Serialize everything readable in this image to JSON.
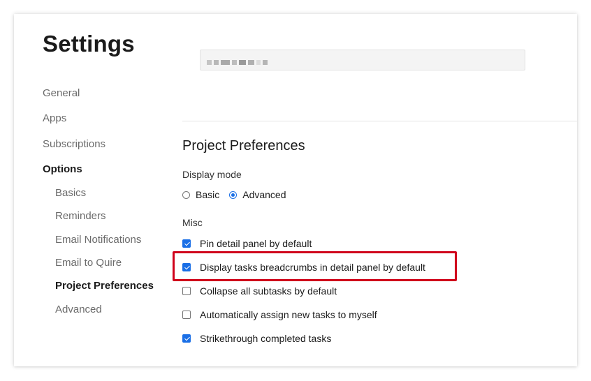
{
  "page": {
    "title": "Settings"
  },
  "sidebar": {
    "items": [
      {
        "label": "General"
      },
      {
        "label": "Apps"
      },
      {
        "label": "Subscriptions"
      },
      {
        "label": "Options"
      }
    ],
    "subitems": [
      {
        "label": "Basics"
      },
      {
        "label": "Reminders"
      },
      {
        "label": "Email Notifications"
      },
      {
        "label": "Email to Quire"
      },
      {
        "label": "Project Preferences"
      },
      {
        "label": "Advanced"
      }
    ],
    "active_item": "Options",
    "active_subitem": "Project Preferences"
  },
  "search": {
    "value": ""
  },
  "section": {
    "title": "Project Preferences",
    "display_mode": {
      "label": "Display mode",
      "options": [
        {
          "label": "Basic",
          "selected": false
        },
        {
          "label": "Advanced",
          "selected": true
        }
      ]
    },
    "misc": {
      "label": "Misc",
      "options": [
        {
          "label": "Pin detail panel by default",
          "checked": true
        },
        {
          "label": "Display tasks breadcrumbs in detail panel by default",
          "checked": true,
          "highlighted": true
        },
        {
          "label": "Collapse all subtasks by default",
          "checked": false
        },
        {
          "label": "Automatically assign new tasks to myself",
          "checked": false
        },
        {
          "label": "Strikethrough completed tasks",
          "checked": true
        }
      ]
    }
  },
  "colors": {
    "accent": "#1a6fe6",
    "highlight": "#d0021b"
  }
}
